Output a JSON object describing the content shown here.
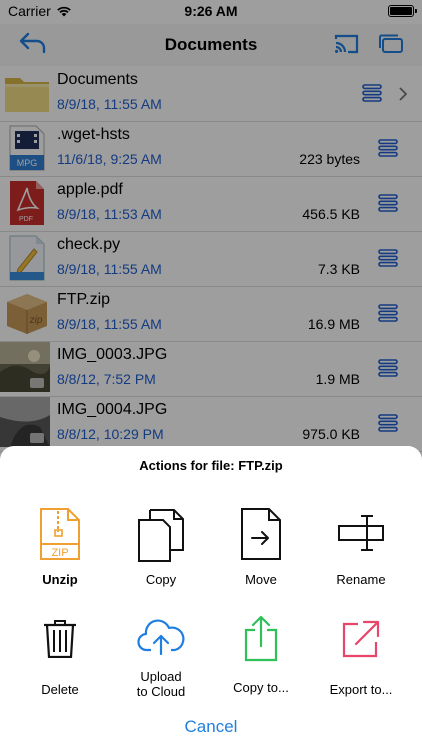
{
  "status": {
    "carrier": "Carrier",
    "time": "9:26 AM"
  },
  "nav": {
    "title": "Documents"
  },
  "files": [
    {
      "name": "Documents",
      "date": "8/9/18, 11:55 AM",
      "size": ""
    },
    {
      "name": ".wget-hsts",
      "date": "11/6/18, 9:25 AM",
      "size": "223 bytes"
    },
    {
      "name": "apple.pdf",
      "date": "8/9/18, 11:53 AM",
      "size": "456.5 KB"
    },
    {
      "name": "check.py",
      "date": "8/9/18, 11:55 AM",
      "size": "7.3 KB"
    },
    {
      "name": "FTP.zip",
      "date": "8/9/18, 11:55 AM",
      "size": "16.9 MB"
    },
    {
      "name": "IMG_0003.JPG",
      "date": "8/8/12, 7:52 PM",
      "size": "1.9 MB"
    },
    {
      "name": "IMG_0004.JPG",
      "date": "8/8/12, 10:29 PM",
      "size": "975.0 KB"
    }
  ],
  "thumb_labels": {
    "mpg": "MPG",
    "pdf": "PDF",
    "zip": "zip"
  },
  "sheet": {
    "heading": "Actions for file: FTP.zip",
    "actions": [
      {
        "label": "Unzip",
        "icon": "zip-file-icon"
      },
      {
        "label": "Copy",
        "icon": "copy-icon"
      },
      {
        "label": "Move",
        "icon": "move-icon"
      },
      {
        "label": "Rename",
        "icon": "rename-icon"
      },
      {
        "label": "Delete",
        "icon": "trash-icon"
      },
      {
        "label": "Upload\nto Cloud",
        "icon": "cloud-upload-icon"
      },
      {
        "label": "Copy to...",
        "icon": "share-icon"
      },
      {
        "label": "Export to...",
        "icon": "export-icon"
      }
    ],
    "cancel": "Cancel",
    "zip_icon_text": "ZIP"
  },
  "colors": {
    "accent": "#1f7fe0",
    "date_blue": "#1f5fd1",
    "unzip_orange": "#f0a030",
    "copyto_green": "#2fc05a",
    "export_pink": "#e8456a"
  }
}
